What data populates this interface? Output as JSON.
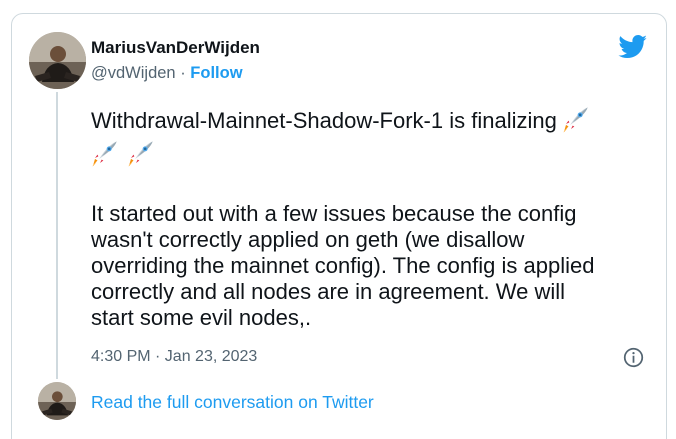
{
  "author": {
    "name": "MariusVanDerWijden",
    "handle": "@vdWijden",
    "separator": " · ",
    "follow_label": "Follow"
  },
  "tweet": {
    "line1": "Withdrawal-Mainnet-Shadow-Fork-1 is finalizing",
    "paragraph2": [
      "It started out with a few issues because the config",
      "wasn't correctly applied on geth (we disallow",
      "overriding the mainnet config). The config is applied",
      "correctly and all nodes are in agreement. We will",
      "start some evil nodes,."
    ],
    "rocket_emoji_count": 3,
    "timestamp": "4:30 PM · Jan 23, 2023"
  },
  "footer": {
    "read_more_label": "Read the full conversation on Twitter"
  },
  "icons": {
    "brand": "twitter-bird-icon",
    "info": "info-icon",
    "emoji": "rocket-emoji"
  },
  "colors": {
    "accent": "#1d9bf0",
    "text": "#0f1419",
    "muted": "#536471",
    "border": "#cfd9de"
  }
}
